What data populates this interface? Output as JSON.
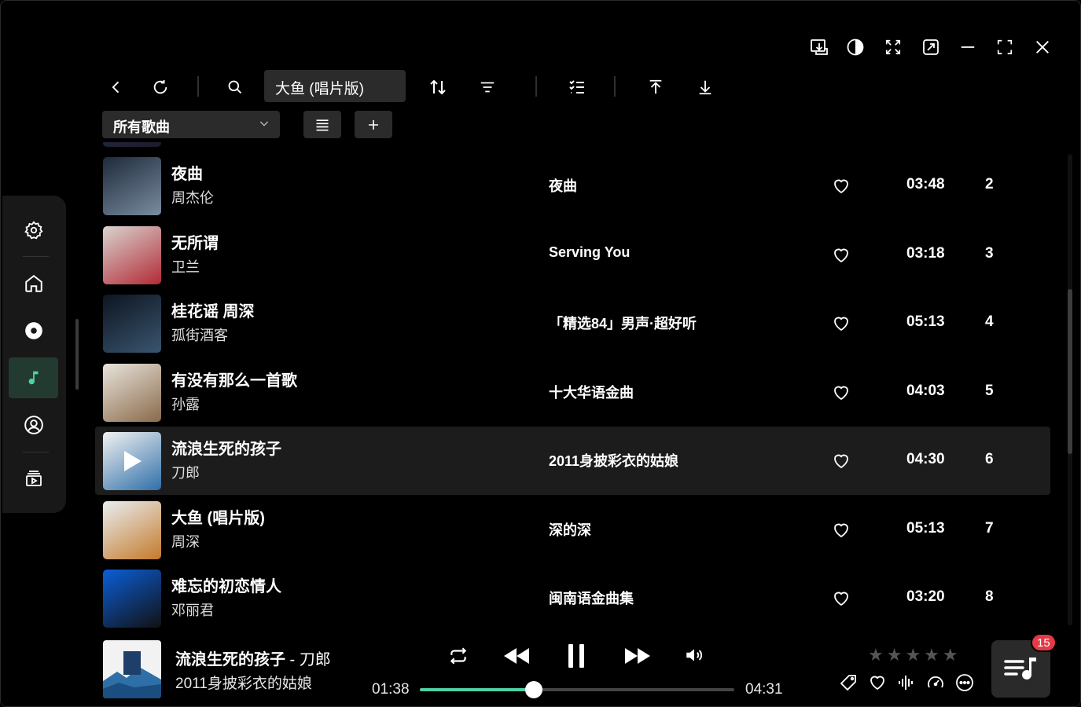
{
  "search": {
    "value": "大鱼 (唱片版)"
  },
  "filter": {
    "selected": "所有歌曲"
  },
  "accent_color": "#4fd1a5",
  "songs": [
    {
      "title": "夜曲",
      "artist": "周杰伦",
      "album": "夜曲",
      "duration": "03:48",
      "index": "2",
      "cover_colors": [
        "#1d2a3a",
        "#7a8ca0"
      ]
    },
    {
      "title": "无所谓",
      "artist": "卫兰",
      "album": "Serving You",
      "duration": "03:18",
      "index": "3",
      "cover_colors": [
        "#d9d4cf",
        "#b22a36"
      ]
    },
    {
      "title": "桂花谣 周深",
      "artist": "孤街酒客",
      "album": "「精选84」男声·超好听",
      "duration": "05:13",
      "index": "4",
      "cover_colors": [
        "#0d1520",
        "#3a5570"
      ]
    },
    {
      "title": "有没有那么一首歌",
      "artist": "孙露",
      "album": "十大华语金曲",
      "duration": "04:03",
      "index": "5",
      "cover_colors": [
        "#e8e4dc",
        "#8a6a4a"
      ]
    },
    {
      "title": "流浪生死的孩子",
      "artist": "刀郎",
      "album": "2011身披彩衣的姑娘",
      "duration": "04:30",
      "index": "6",
      "cover_colors": [
        "#f2f2f2",
        "#2f6fa8"
      ]
    },
    {
      "title": "大鱼 (唱片版)",
      "artist": "周深",
      "album": "深的深",
      "duration": "05:13",
      "index": "7",
      "cover_colors": [
        "#e9eef2",
        "#c47a2a"
      ]
    },
    {
      "title": "难忘的初恋情人",
      "artist": "邓丽君",
      "album": "闽南语金曲集",
      "duration": "03:20",
      "index": "8",
      "cover_colors": [
        "#0b5fd8",
        "#111111"
      ]
    }
  ],
  "player": {
    "title": "流浪生死的孩子",
    "artist_sep": " - ",
    "artist": "刀郎",
    "album": "2011身披彩衣的姑娘",
    "elapsed": "01:38",
    "total": "04:31",
    "progress": 0.362,
    "rating": 0,
    "rating_max": 5,
    "stars": "★★★★★",
    "queue_count": "15"
  },
  "icons": {
    "window": [
      "download-icon",
      "theme-contrast-icon",
      "mini-mode-icon",
      "pop-out-icon",
      "minimize-icon",
      "maximize-icon",
      "close-icon"
    ],
    "toolbar": [
      "back-icon",
      "refresh-icon",
      "search-icon",
      "sort-icon",
      "filter-icon",
      "multi-select-icon",
      "scroll-top-icon",
      "scroll-bottom-icon"
    ],
    "sidebar": [
      "settings-icon",
      "home-icon",
      "disc-icon",
      "music-note-icon",
      "user-icon",
      "playlist-icon"
    ]
  }
}
